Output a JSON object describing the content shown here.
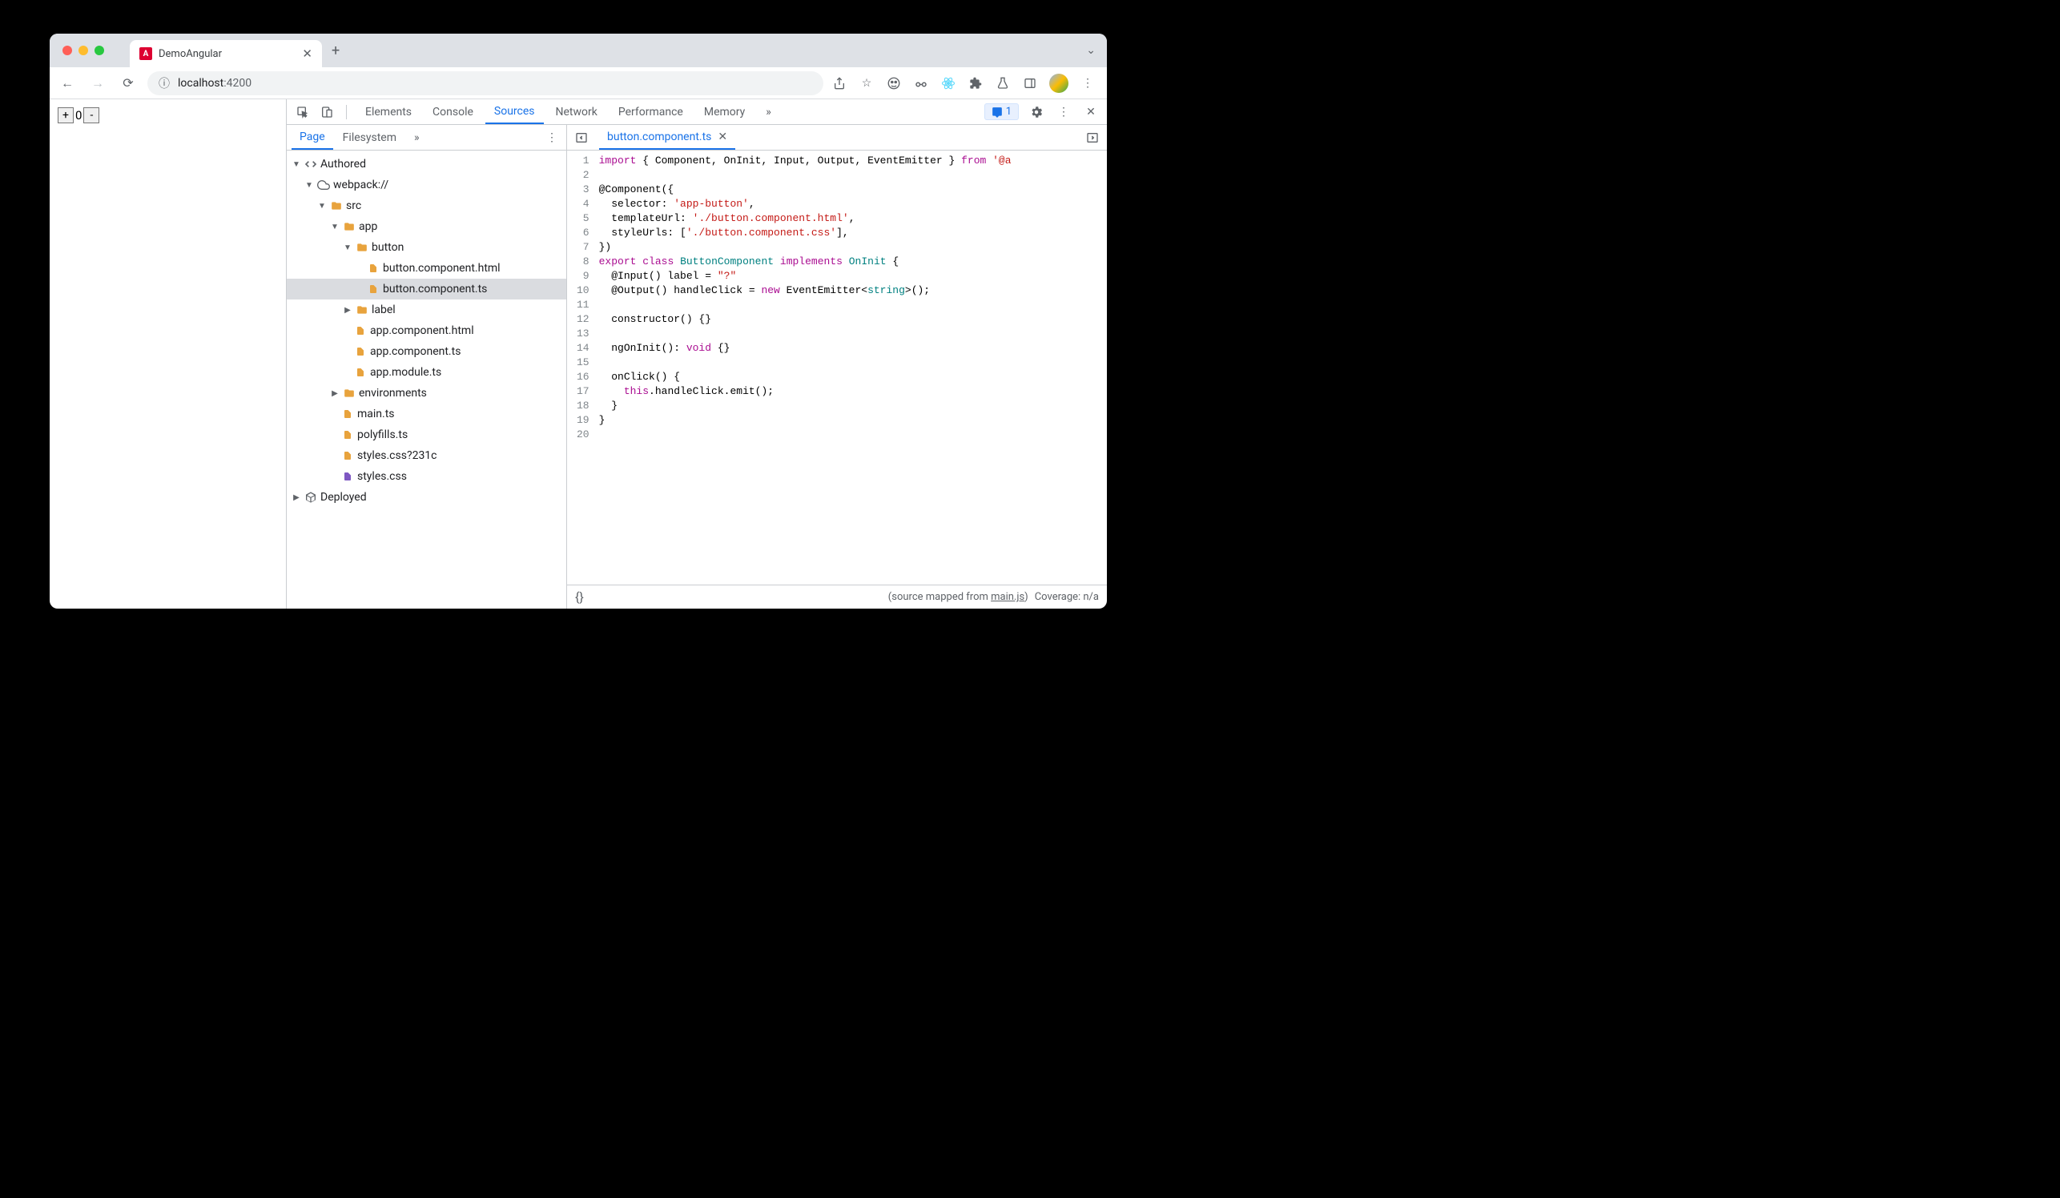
{
  "browser": {
    "tab_title": "DemoAngular",
    "url_host": "localhost",
    "url_port": ":4200"
  },
  "page": {
    "plus": "+",
    "value": "0",
    "minus": "-"
  },
  "devtools": {
    "tabs": [
      "Elements",
      "Console",
      "Sources",
      "Network",
      "Performance",
      "Memory"
    ],
    "active_tab": "Sources",
    "issues_count": "1",
    "sources_subtabs": [
      "Page",
      "Filesystem"
    ],
    "active_subtab": "Page",
    "open_file": "button.component.ts",
    "footer_prefix": "(source mapped from ",
    "footer_link": "main.js",
    "footer_suffix": ")",
    "coverage": "Coverage: n/a"
  },
  "tree": {
    "authored": "Authored",
    "webpack": "webpack://",
    "src": "src",
    "app": "app",
    "button": "button",
    "btn_html": "button.component.html",
    "btn_ts": "button.component.ts",
    "label": "label",
    "app_html": "app.component.html",
    "app_ts": "app.component.ts",
    "app_module": "app.module.ts",
    "environments": "environments",
    "main_ts": "main.ts",
    "polyfills": "polyfills.ts",
    "styles_q": "styles.css?231c",
    "styles": "styles.css",
    "deployed": "Deployed"
  },
  "code": {
    "lines": 20,
    "l1": {
      "a": "import",
      "b": " { Component, OnInit, Input, Output, EventEmitter } ",
      "c": "from",
      "d": " ",
      "e": "'@a"
    },
    "l3": "@Component({",
    "l4": {
      "a": "  selector: ",
      "b": "'app-button'",
      "c": ","
    },
    "l5": {
      "a": "  templateUrl: ",
      "b": "'./button.component.html'",
      "c": ","
    },
    "l6": {
      "a": "  styleUrls: [",
      "b": "'./button.component.css'",
      "c": "],"
    },
    "l7": "})",
    "l8": {
      "a": "export",
      "b": " ",
      "c": "class",
      "d": " ",
      "e": "ButtonComponent",
      "f": " ",
      "g": "implements",
      "h": " ",
      "i": "OnInit",
      "j": " {"
    },
    "l9": {
      "a": "  @Input() label = ",
      "b": "\"?\""
    },
    "l10": {
      "a": "  @Output() handleClick = ",
      "b": "new",
      "c": " EventEmitter<",
      "d": "string",
      "e": ">();"
    },
    "l12": "  constructor() {}",
    "l14": {
      "a": "  ngOnInit(): ",
      "b": "void",
      "c": " {}"
    },
    "l16": "  onClick() {",
    "l17": {
      "a": "    ",
      "b": "this",
      "c": ".handleClick.emit();"
    },
    "l18": "  }",
    "l19": "}"
  }
}
